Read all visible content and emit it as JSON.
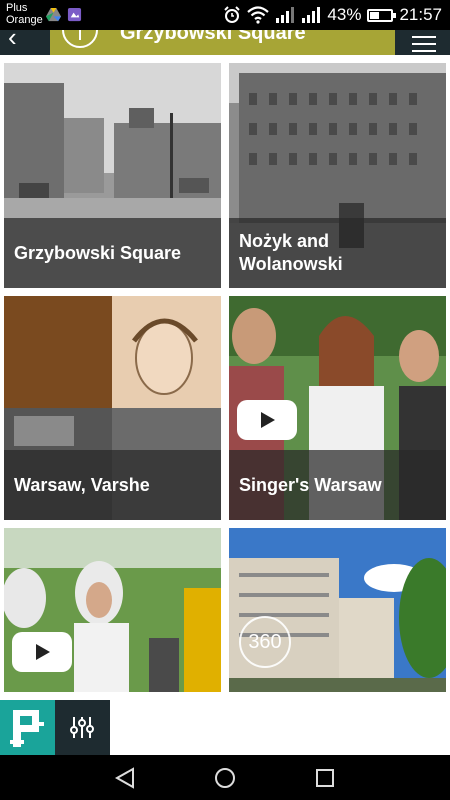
{
  "status_bar": {
    "carrier_line1": "Plus",
    "carrier_line2": "Orange",
    "battery_percent": "43%",
    "battery_level": 0.43,
    "time": "21:57"
  },
  "header": {
    "title": "Grzybowski Square"
  },
  "tiles": [
    {
      "caption": "Grzybowski Square",
      "media": "photo"
    },
    {
      "caption_line1": "Nożyk and",
      "caption_line2": "Wolanowski",
      "media": "photo"
    },
    {
      "caption": "Warsaw, Varshe",
      "media": "photo"
    },
    {
      "caption": "Singer's Warsaw",
      "media": "video"
    },
    {
      "caption": "",
      "media": "video"
    },
    {
      "caption": "",
      "media": "panorama",
      "badge": "360"
    }
  ],
  "icons": {
    "back": "back-arrow-icon",
    "menu": "hamburger-menu-icon",
    "logo": "app-logo-icon",
    "filter": "sliders-filter-icon",
    "nav_back": "triangle-back-icon",
    "nav_home": "circle-home-icon",
    "nav_recent": "square-recent-icon"
  },
  "colors": {
    "header_dark": "#1e2b30",
    "header_accent": "#a7a536",
    "logo_teal": "#1aa49a"
  }
}
